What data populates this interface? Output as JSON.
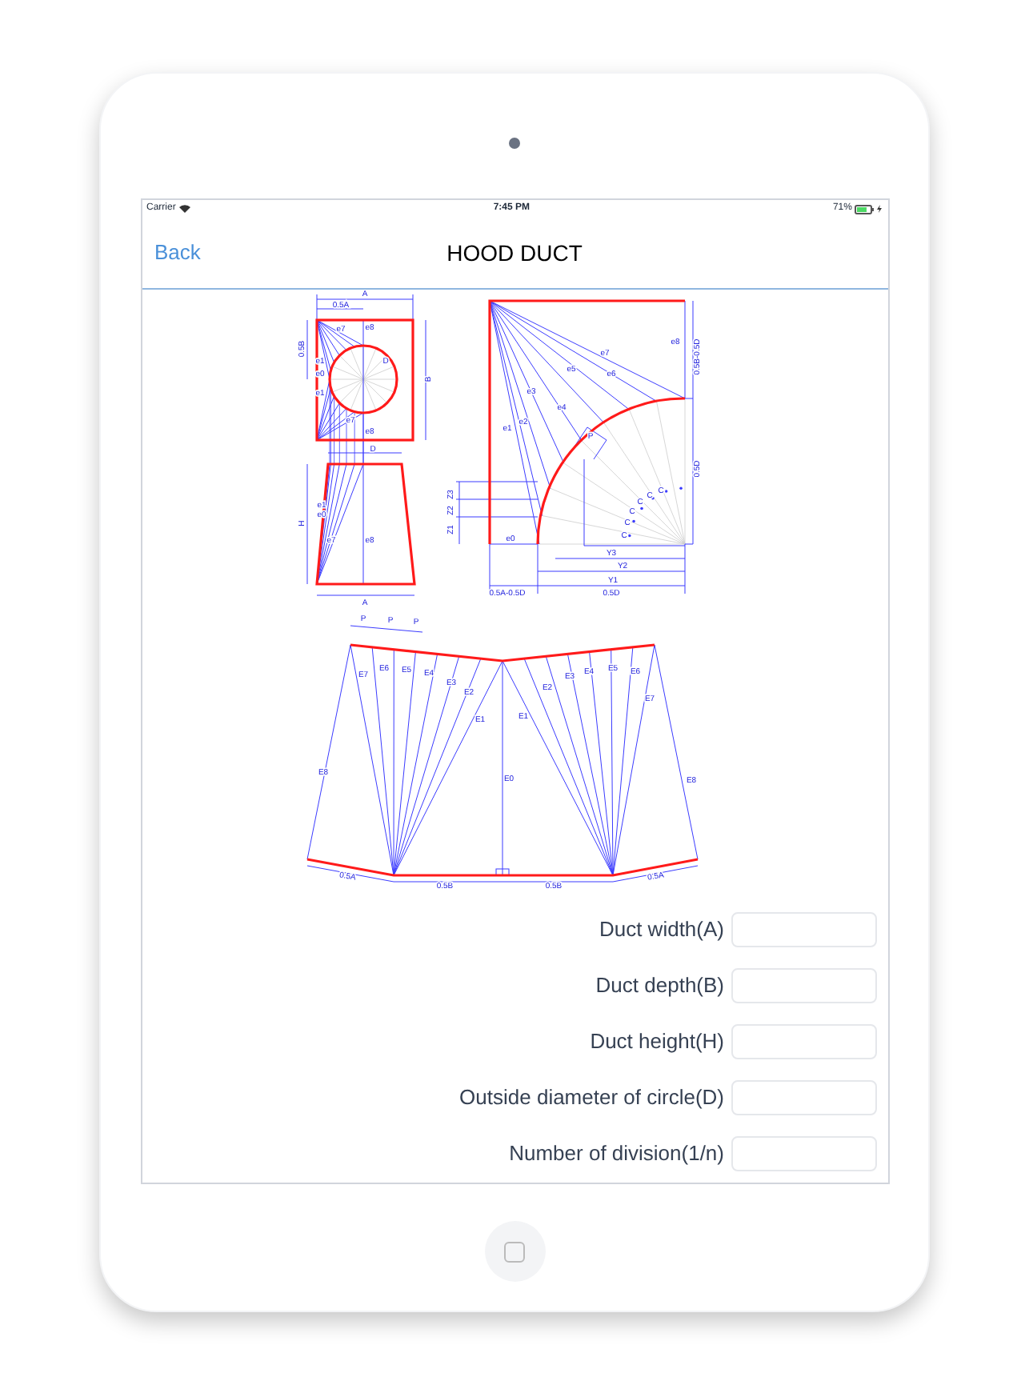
{
  "status_bar": {
    "carrier": "Carrier",
    "time": "7:45 PM",
    "battery": "71%"
  },
  "nav": {
    "back": "Back",
    "title": "HOOD DUCT"
  },
  "diagrams": [
    {
      "kind": "plan_elevation",
      "labels": [
        "A",
        "0.5A",
        "0.5B",
        "e7",
        "e8",
        "e1",
        "e0",
        "e1",
        "D",
        "B",
        "e7",
        "e8",
        "D",
        "H",
        "e1",
        "e0",
        "e7",
        "e8",
        "A"
      ]
    },
    {
      "kind": "quarter_bend",
      "labels": [
        "e8",
        "0.5B-0.5D",
        "e7",
        "e6",
        "e5",
        "e3",
        "e4",
        "e2",
        "e1",
        "P",
        "0.5D",
        "C",
        "C",
        "C",
        "C",
        "C",
        "C",
        "Z3",
        "Z2",
        "Z1",
        "e0",
        "Y3",
        "Y2",
        "Y1",
        "0.5A-0.5D",
        "0.5D"
      ]
    },
    {
      "kind": "flat_pattern",
      "labels": [
        "P",
        "P",
        "P",
        "E7",
        "E6",
        "E5",
        "E4",
        "E3",
        "E2",
        "E1",
        "E0",
        "E1",
        "E2",
        "E3",
        "E4",
        "E5",
        "E6",
        "E7",
        "E8",
        "E8",
        "0.5A",
        "0.5B",
        "0.5B",
        "0.5A"
      ]
    }
  ],
  "fields": [
    {
      "label": "Duct width(A)"
    },
    {
      "label": "Duct depth(B)"
    },
    {
      "label": "Duct height(H)"
    },
    {
      "label": "Outside diameter of circle(D)"
    },
    {
      "label": "Number of division(1/n)"
    }
  ]
}
